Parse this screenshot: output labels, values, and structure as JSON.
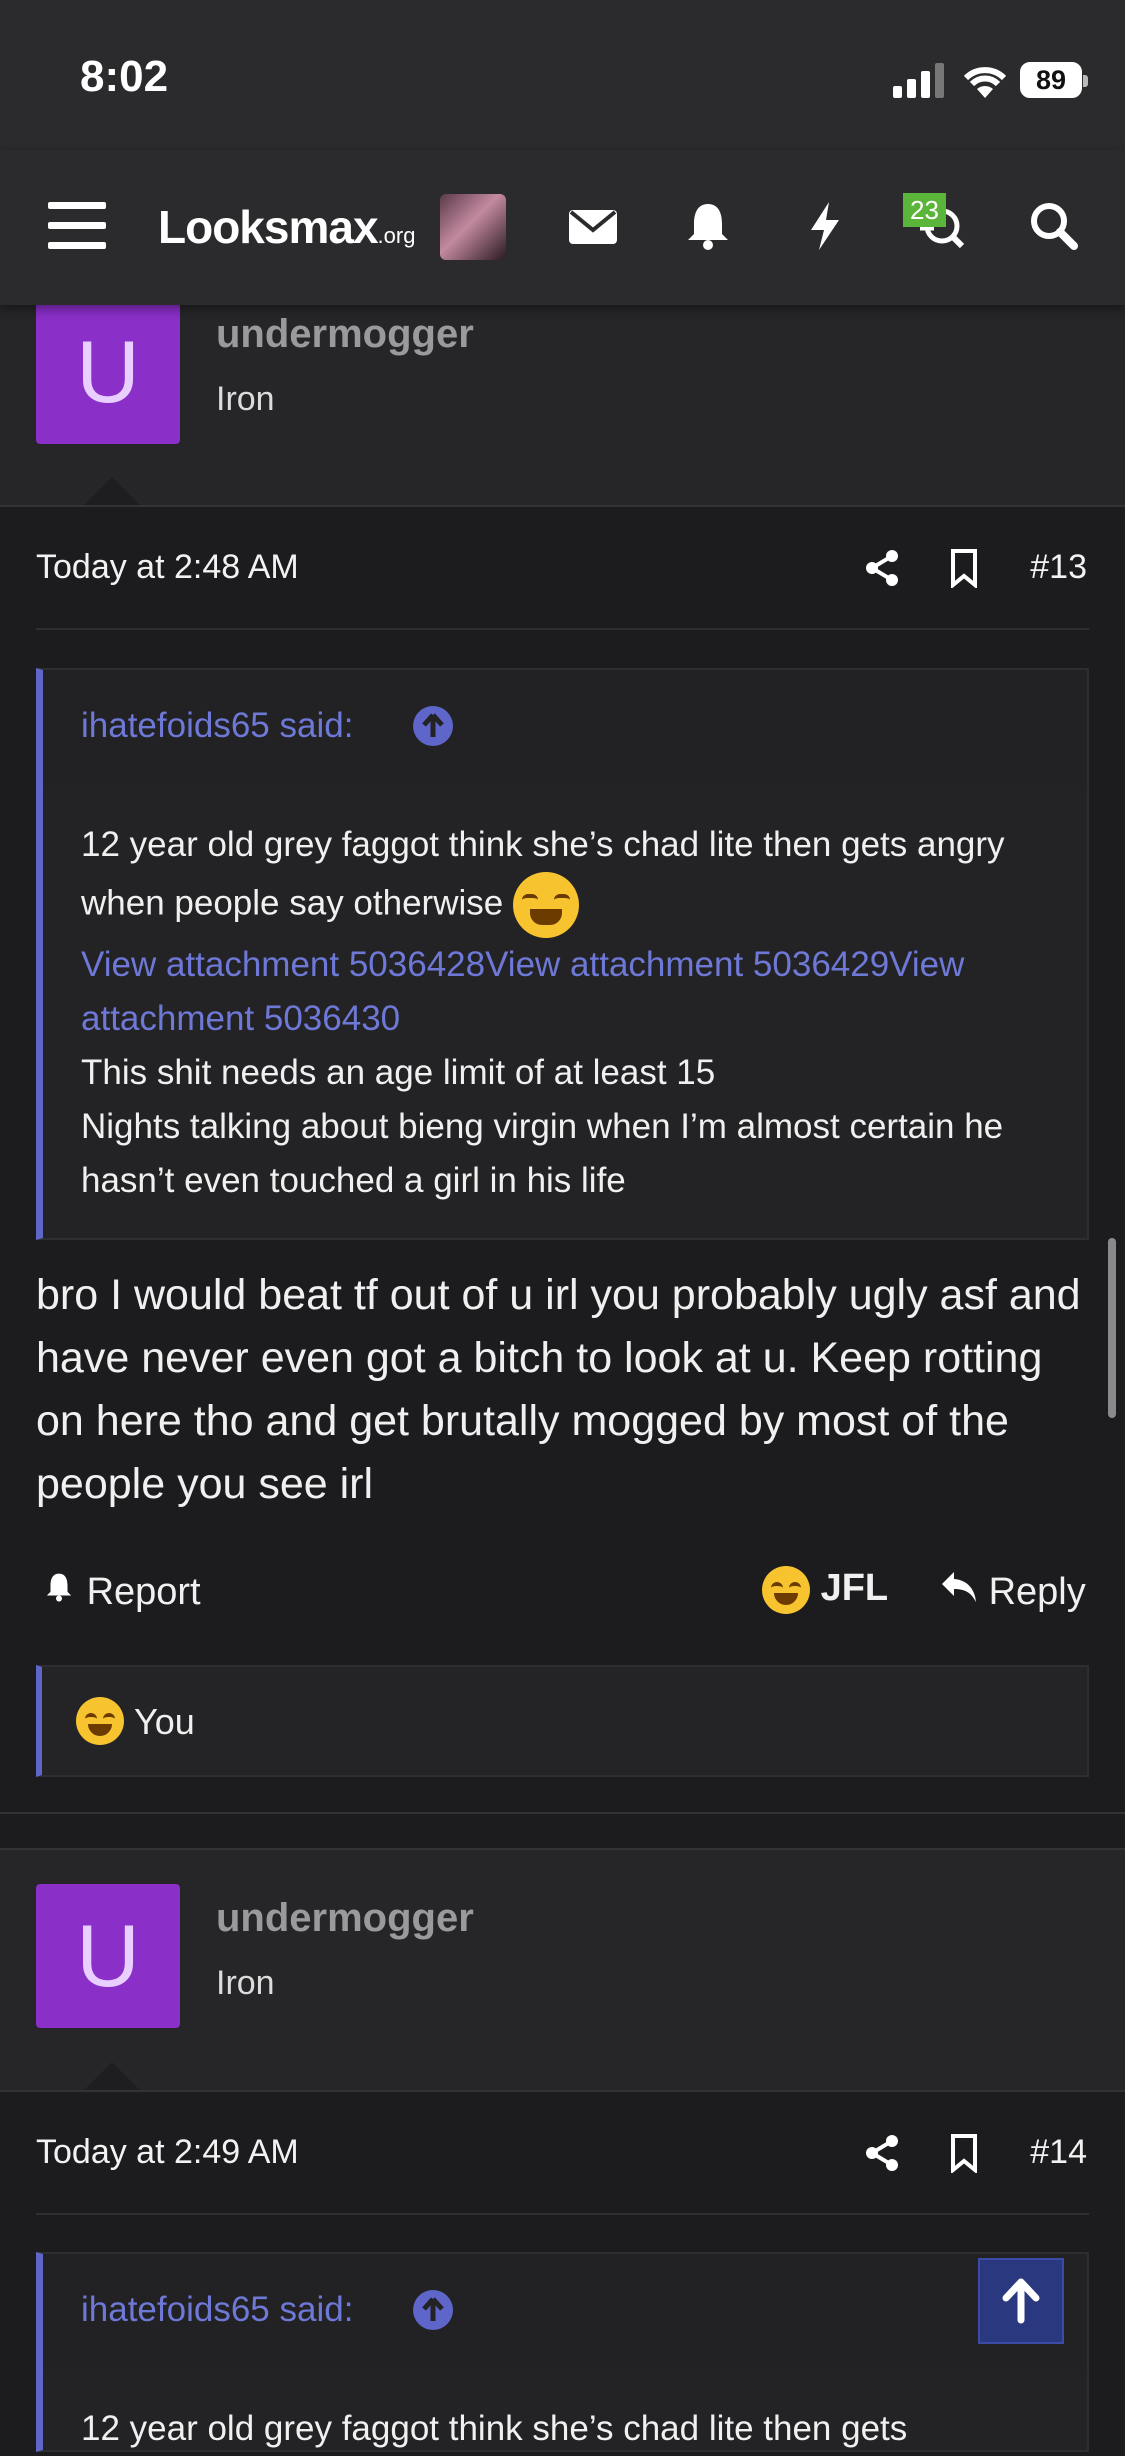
{
  "status_bar": {
    "time": "8:02",
    "battery": "89"
  },
  "navbar": {
    "logo_main": "Looksmax",
    "logo_suffix": ".org",
    "conversations_badge": "23"
  },
  "posts": [
    {
      "avatar_letter": "U",
      "username": "undermogger",
      "rank": "Iron",
      "date": "Today at 2:48 AM",
      "number": "#13",
      "quote": {
        "author": "ihatefoids65 said:",
        "line1": "12 year old grey faggot think she’s chad lite then gets angry when people say otherwise",
        "attachments": "View attachment 5036428View attachment 5036429View attachment 5036430",
        "line2": "This shit needs an age limit of at least 15",
        "line3": "Nights talking about bieng virgin when I’m almost certain he hasn’t even touched a girl in his life"
      },
      "body": "bro I would beat tf out of u irl you probably ugly asf and have never even got a bitch to look at u. Keep rotting on here tho and get brutally mogged by most of the people you see irl",
      "actions": {
        "report": "Report",
        "reaction": "JFL",
        "reply": "Reply"
      },
      "reactions_by": "You"
    },
    {
      "avatar_letter": "U",
      "username": "undermogger",
      "rank": "Iron",
      "date": "Today at 2:49 AM",
      "number": "#14",
      "quote": {
        "author": "ihatefoids65 said:",
        "line1": "12 year old grey faggot think she’s chad lite then gets"
      }
    }
  ],
  "colors": {
    "accent": "#5e67c9",
    "avatar": "#8b2fc9",
    "badge": "#5bb53a"
  }
}
